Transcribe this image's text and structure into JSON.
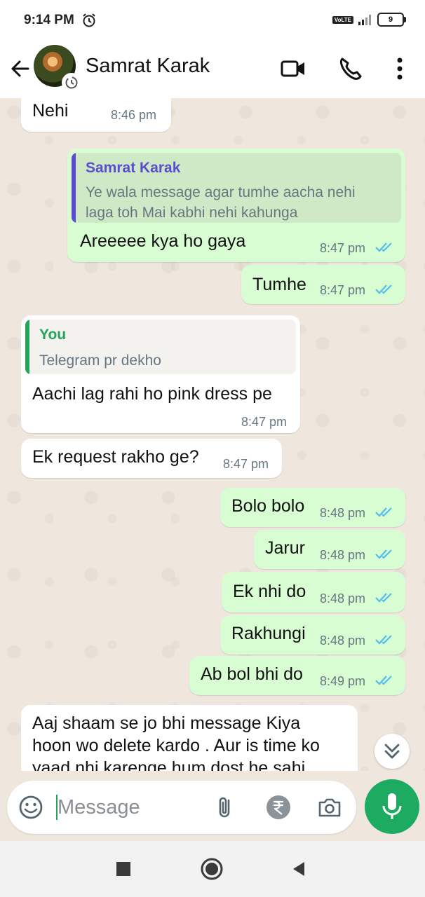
{
  "status_bar": {
    "time": "9:14 PM",
    "network": "VoLTE",
    "battery": "9"
  },
  "header": {
    "contact_name": "Samrat Karak"
  },
  "messages": [
    {
      "text": "Nehi",
      "time": "8:46 pm"
    },
    {
      "quote_name": "Samrat Karak",
      "quote_line1": "Ye wala message agar tumhe aacha nehi",
      "quote_line2": "laga toh Mai kabhi nehi kahunga",
      "text": "Areeeee kya ho gaya",
      "time": "8:47 pm"
    },
    {
      "text": "Tumhe",
      "time": "8:47 pm"
    },
    {
      "quote_name": "You",
      "quote_line1": "Telegram pr dekho",
      "text": "Aachi lag rahi ho pink dress pe",
      "time": "8:47 pm"
    },
    {
      "text": "Ek request rakho ge?",
      "time": "8:47 pm"
    },
    {
      "text": "Bolo bolo",
      "time": "8:48 pm"
    },
    {
      "text": "Jarur",
      "time": "8:48 pm"
    },
    {
      "text": "Ek nhi do",
      "time": "8:48 pm"
    },
    {
      "text": "Rakhungi",
      "time": "8:48 pm"
    },
    {
      "text": "Ab bol bhi do",
      "time": "8:49 pm"
    },
    {
      "line1": "Aaj shaam se jo bhi message Kiya",
      "line2": "hoon wo delete kardo . Aur is time ko",
      "line3": "yaad nhi karenge hum dost he sahi"
    }
  ],
  "input": {
    "placeholder": "Message"
  },
  "colors": {
    "outgoing_bubble": "#d9fdd3",
    "incoming_bubble": "#ffffff",
    "accent_green": "#1daa61",
    "read_tick": "#53bdeb"
  }
}
